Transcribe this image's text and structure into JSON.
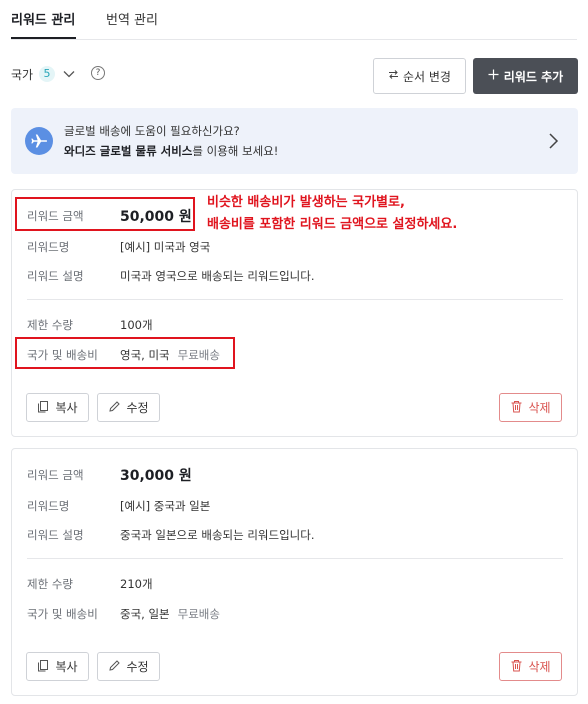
{
  "tabs": {
    "active": "리워드 관리",
    "inactive": "번역 관리"
  },
  "toolbar": {
    "country_label": "국가",
    "country_count": "5",
    "help_glyph": "?",
    "order_button": "순서 변경",
    "add_button": "리워드 추가"
  },
  "banner": {
    "line1": "글로벌 배송에 도움이 필요하신가요?",
    "line2_bold": "와디즈 글로벌 물류 서비스",
    "line2_rest": "를 이용해 보세요!"
  },
  "labels": {
    "amount": "리워드 금액",
    "name": "리워드명",
    "description": "리워드 설명",
    "limit": "제한 수량",
    "country_shipping": "국가 및 배송비"
  },
  "buttons": {
    "copy": "복사",
    "edit": "수정",
    "delete": "삭제"
  },
  "rewards": [
    {
      "amount": "50,000 원",
      "name": "[예시] 미국과 영국",
      "description": "미국과 영국으로 배송되는 리워드입니다.",
      "limit": "100개",
      "countries": "영국, 미국",
      "shipping": "무료배송"
    },
    {
      "amount": "30,000 원",
      "name": "[예시] 중국과 일본",
      "description": "중국과 일본으로 배송되는 리워드입니다.",
      "limit": "210개",
      "countries": "중국, 일본",
      "shipping": "무료배송"
    }
  ],
  "annotation": {
    "line1": "비슷한 배송비가 발생하는 국가별로,",
    "line2": "배송비를 포함한 리워드 금액으로 설정하세요."
  },
  "colors": {
    "accent_teal": "#28a6b8",
    "annotation_red": "#e0141e",
    "add_button_bg": "#4b4f56"
  }
}
